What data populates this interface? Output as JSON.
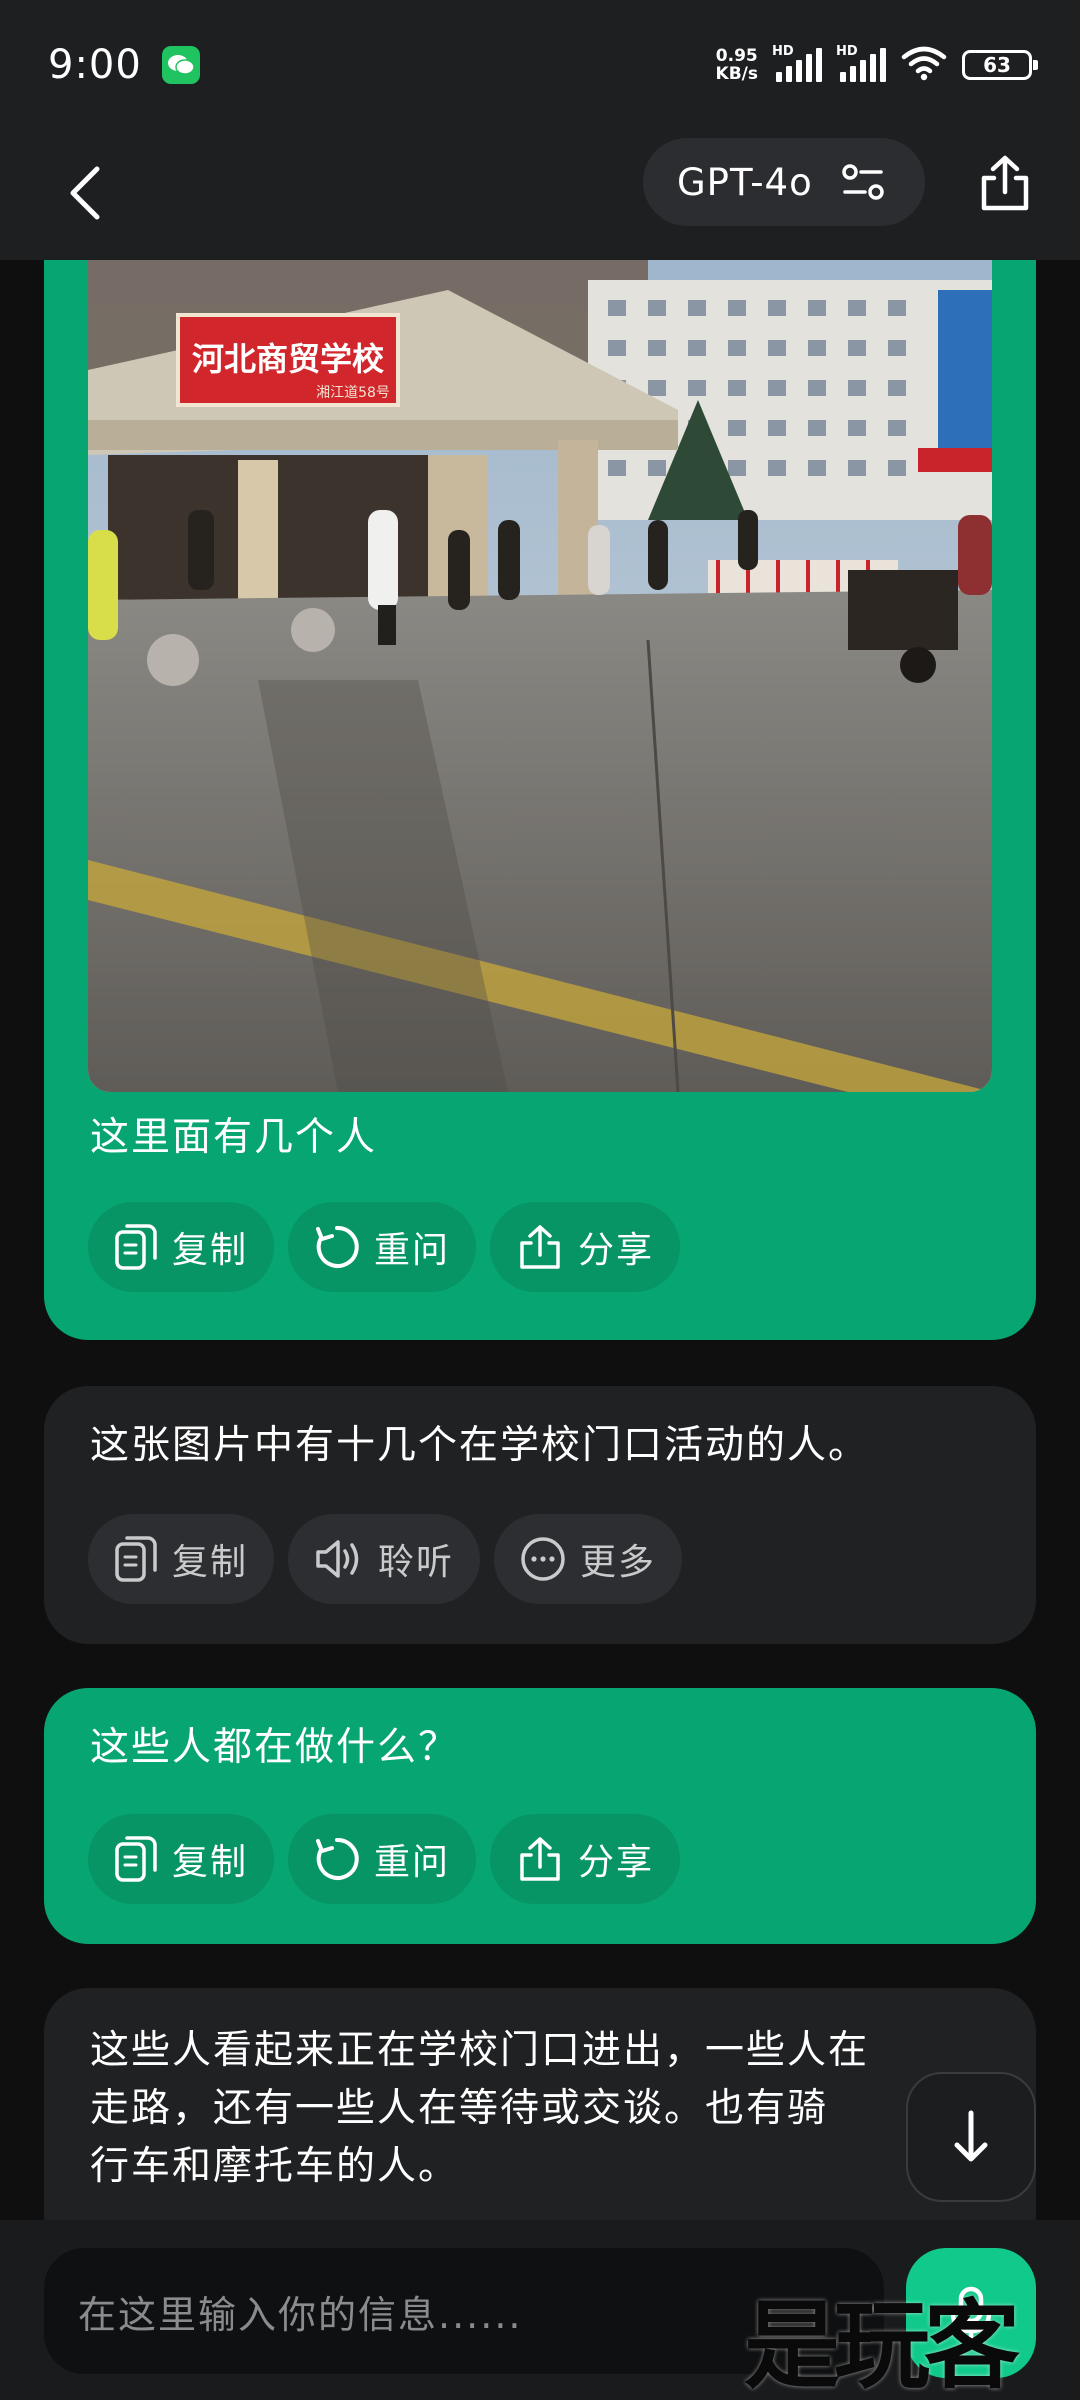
{
  "status_bar": {
    "time": "9:00",
    "net_speed_value": "0.95",
    "net_speed_unit": "KB/s",
    "hd_label": "HD",
    "battery": "63"
  },
  "header": {
    "model_name": "GPT-4o"
  },
  "messages": [
    {
      "role": "user",
      "has_image": true,
      "image_sign_text": "河北商贸学校",
      "image_sign_subtext": "湘江道58号",
      "text": "这里面有几个人",
      "actions": [
        "复制",
        "重问",
        "分享"
      ]
    },
    {
      "role": "assistant",
      "text": "这张图片中有十几个在学校门口活动的人。",
      "actions": [
        "复制",
        "聆听",
        "更多"
      ]
    },
    {
      "role": "user",
      "text": "这些人都在做什么？",
      "actions": [
        "复制",
        "重问",
        "分享"
      ]
    },
    {
      "role": "assistant",
      "text_lines": [
        "这些人看起来正在学校门口进出，一些人在",
        "走路，还有一些人在等待或交谈。也有骑",
        "行车和摩托车的人。"
      ]
    }
  ],
  "input": {
    "placeholder": "在这里输入你的信息......"
  },
  "watermark": "是玩客",
  "colors": {
    "user_bubble": "#07a571",
    "assistant_bubble": "#202123",
    "accent": "#10c98a",
    "background": "#0f0f10"
  },
  "icons": [
    "wechat-icon",
    "signal-icon",
    "wifi-icon",
    "battery-icon",
    "back-arrow-icon",
    "settings-sliders-icon",
    "share-icon",
    "copy-icon",
    "retry-icon",
    "speaker-icon",
    "more-icon",
    "arrow-down-icon",
    "mic-icon"
  ]
}
